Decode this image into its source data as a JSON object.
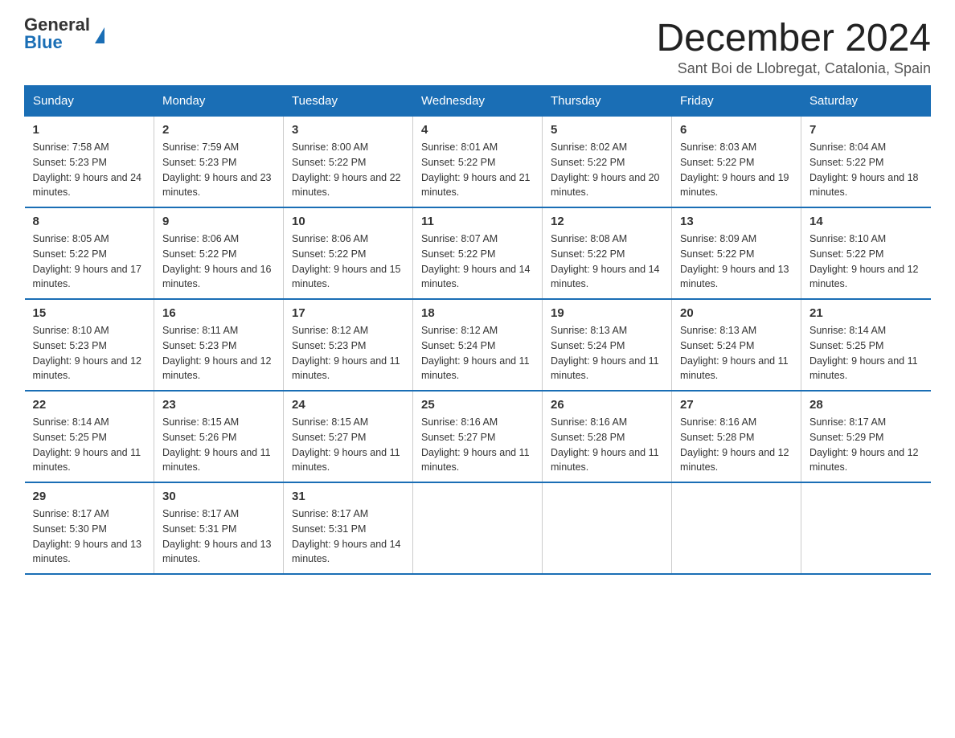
{
  "header": {
    "logo_general": "General",
    "logo_blue": "Blue",
    "title": "December 2024",
    "location": "Sant Boi de Llobregat, Catalonia, Spain"
  },
  "days_of_week": [
    "Sunday",
    "Monday",
    "Tuesday",
    "Wednesday",
    "Thursday",
    "Friday",
    "Saturday"
  ],
  "weeks": [
    [
      {
        "day": "1",
        "sunrise": "7:58 AM",
        "sunset": "5:23 PM",
        "daylight": "9 hours and 24 minutes."
      },
      {
        "day": "2",
        "sunrise": "7:59 AM",
        "sunset": "5:23 PM",
        "daylight": "9 hours and 23 minutes."
      },
      {
        "day": "3",
        "sunrise": "8:00 AM",
        "sunset": "5:22 PM",
        "daylight": "9 hours and 22 minutes."
      },
      {
        "day": "4",
        "sunrise": "8:01 AM",
        "sunset": "5:22 PM",
        "daylight": "9 hours and 21 minutes."
      },
      {
        "day": "5",
        "sunrise": "8:02 AM",
        "sunset": "5:22 PM",
        "daylight": "9 hours and 20 minutes."
      },
      {
        "day": "6",
        "sunrise": "8:03 AM",
        "sunset": "5:22 PM",
        "daylight": "9 hours and 19 minutes."
      },
      {
        "day": "7",
        "sunrise": "8:04 AM",
        "sunset": "5:22 PM",
        "daylight": "9 hours and 18 minutes."
      }
    ],
    [
      {
        "day": "8",
        "sunrise": "8:05 AM",
        "sunset": "5:22 PM",
        "daylight": "9 hours and 17 minutes."
      },
      {
        "day": "9",
        "sunrise": "8:06 AM",
        "sunset": "5:22 PM",
        "daylight": "9 hours and 16 minutes."
      },
      {
        "day": "10",
        "sunrise": "8:06 AM",
        "sunset": "5:22 PM",
        "daylight": "9 hours and 15 minutes."
      },
      {
        "day": "11",
        "sunrise": "8:07 AM",
        "sunset": "5:22 PM",
        "daylight": "9 hours and 14 minutes."
      },
      {
        "day": "12",
        "sunrise": "8:08 AM",
        "sunset": "5:22 PM",
        "daylight": "9 hours and 14 minutes."
      },
      {
        "day": "13",
        "sunrise": "8:09 AM",
        "sunset": "5:22 PM",
        "daylight": "9 hours and 13 minutes."
      },
      {
        "day": "14",
        "sunrise": "8:10 AM",
        "sunset": "5:22 PM",
        "daylight": "9 hours and 12 minutes."
      }
    ],
    [
      {
        "day": "15",
        "sunrise": "8:10 AM",
        "sunset": "5:23 PM",
        "daylight": "9 hours and 12 minutes."
      },
      {
        "day": "16",
        "sunrise": "8:11 AM",
        "sunset": "5:23 PM",
        "daylight": "9 hours and 12 minutes."
      },
      {
        "day": "17",
        "sunrise": "8:12 AM",
        "sunset": "5:23 PM",
        "daylight": "9 hours and 11 minutes."
      },
      {
        "day": "18",
        "sunrise": "8:12 AM",
        "sunset": "5:24 PM",
        "daylight": "9 hours and 11 minutes."
      },
      {
        "day": "19",
        "sunrise": "8:13 AM",
        "sunset": "5:24 PM",
        "daylight": "9 hours and 11 minutes."
      },
      {
        "day": "20",
        "sunrise": "8:13 AM",
        "sunset": "5:24 PM",
        "daylight": "9 hours and 11 minutes."
      },
      {
        "day": "21",
        "sunrise": "8:14 AM",
        "sunset": "5:25 PM",
        "daylight": "9 hours and 11 minutes."
      }
    ],
    [
      {
        "day": "22",
        "sunrise": "8:14 AM",
        "sunset": "5:25 PM",
        "daylight": "9 hours and 11 minutes."
      },
      {
        "day": "23",
        "sunrise": "8:15 AM",
        "sunset": "5:26 PM",
        "daylight": "9 hours and 11 minutes."
      },
      {
        "day": "24",
        "sunrise": "8:15 AM",
        "sunset": "5:27 PM",
        "daylight": "9 hours and 11 minutes."
      },
      {
        "day": "25",
        "sunrise": "8:16 AM",
        "sunset": "5:27 PM",
        "daylight": "9 hours and 11 minutes."
      },
      {
        "day": "26",
        "sunrise": "8:16 AM",
        "sunset": "5:28 PM",
        "daylight": "9 hours and 11 minutes."
      },
      {
        "day": "27",
        "sunrise": "8:16 AM",
        "sunset": "5:28 PM",
        "daylight": "9 hours and 12 minutes."
      },
      {
        "day": "28",
        "sunrise": "8:17 AM",
        "sunset": "5:29 PM",
        "daylight": "9 hours and 12 minutes."
      }
    ],
    [
      {
        "day": "29",
        "sunrise": "8:17 AM",
        "sunset": "5:30 PM",
        "daylight": "9 hours and 13 minutes."
      },
      {
        "day": "30",
        "sunrise": "8:17 AM",
        "sunset": "5:31 PM",
        "daylight": "9 hours and 13 minutes."
      },
      {
        "day": "31",
        "sunrise": "8:17 AM",
        "sunset": "5:31 PM",
        "daylight": "9 hours and 14 minutes."
      },
      null,
      null,
      null,
      null
    ]
  ]
}
